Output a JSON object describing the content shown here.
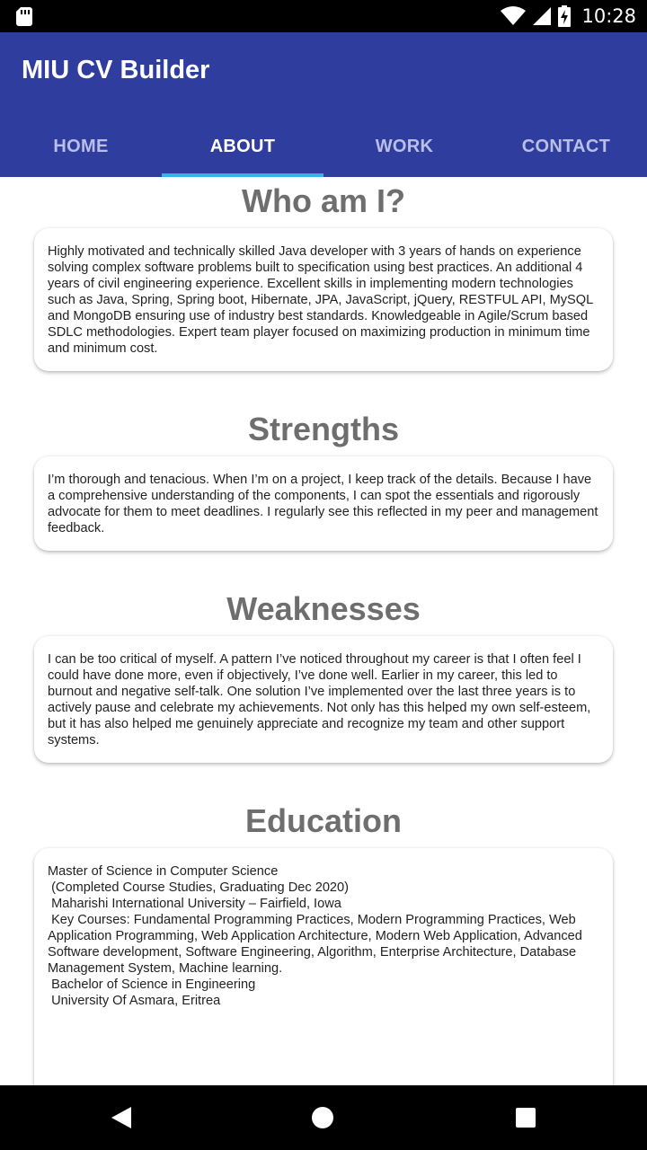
{
  "status_bar": {
    "time": "10:28",
    "icons": [
      "sd-card-icon",
      "wifi-icon",
      "signal-icon",
      "battery-charging-icon"
    ]
  },
  "app": {
    "title": "MIU CV Builder",
    "brand_color": "#2f3d9f",
    "indicator_color": "#35b3e6"
  },
  "tabs": [
    {
      "label": "HOME",
      "active": false
    },
    {
      "label": "ABOUT",
      "active": true
    },
    {
      "label": "WORK",
      "active": false
    },
    {
      "label": "CONTACT",
      "active": false
    }
  ],
  "sections": {
    "who": {
      "title": "Who am I?",
      "body": "Highly motivated and technically skilled Java developer with 3 years of hands on experience solving complex software problems built to specification using best practices. An additional 4 years of civil engineering experience. Excellent skills in implementing modern technologies such as Java, Spring, Spring boot, Hibernate, JPA, JavaScript, jQuery, RESTFUL API, MySQL and MongoDB ensuring use of industry best standards. Knowledgeable in Agile/Scrum based SDLC methodologies. Expert team player focused on maximizing production in minimum time and minimum cost."
    },
    "strengths": {
      "title": "Strengths",
      "body": "I’m thorough and tenacious. When I’m on a project, I keep track of the details. Because I have a comprehensive understanding of the components, I can spot the essentials and rigorously advocate for them to meet deadlines. I regularly see this reflected in my peer and management feedback."
    },
    "weaknesses": {
      "title": "Weaknesses",
      "body": "I can be too critical of myself. A pattern I’ve noticed throughout my career is that I often feel I could have done more, even if objectively, I’ve done well. Earlier in my career, this led to burnout and negative self-talk. One solution I’ve implemented over the last three years is to actively pause and celebrate my achievements. Not only has this helped my own self-esteem, but it has also helped me genuinely appreciate and recognize my team and other support systems."
    },
    "education": {
      "title": "Education",
      "lines": [
        "Master of Science in Computer Science",
        " (Completed Course Studies, Graduating Dec 2020)",
        " Maharishi International University – Fairfield, Iowa",
        " Key Courses: Fundamental Programming Practices, Modern Programming Practices, Web Application Programming, Web Application Architecture, Modern Web Application, Advanced Software development, Software Engineering, Algorithm, Enterprise Architecture, Database Management System, Machine learning.",
        " Bachelor of Science in Engineering",
        " University Of Asmara, Eritrea"
      ]
    }
  },
  "nav_bar": {
    "buttons": [
      "back-button",
      "home-button",
      "recents-button"
    ]
  }
}
